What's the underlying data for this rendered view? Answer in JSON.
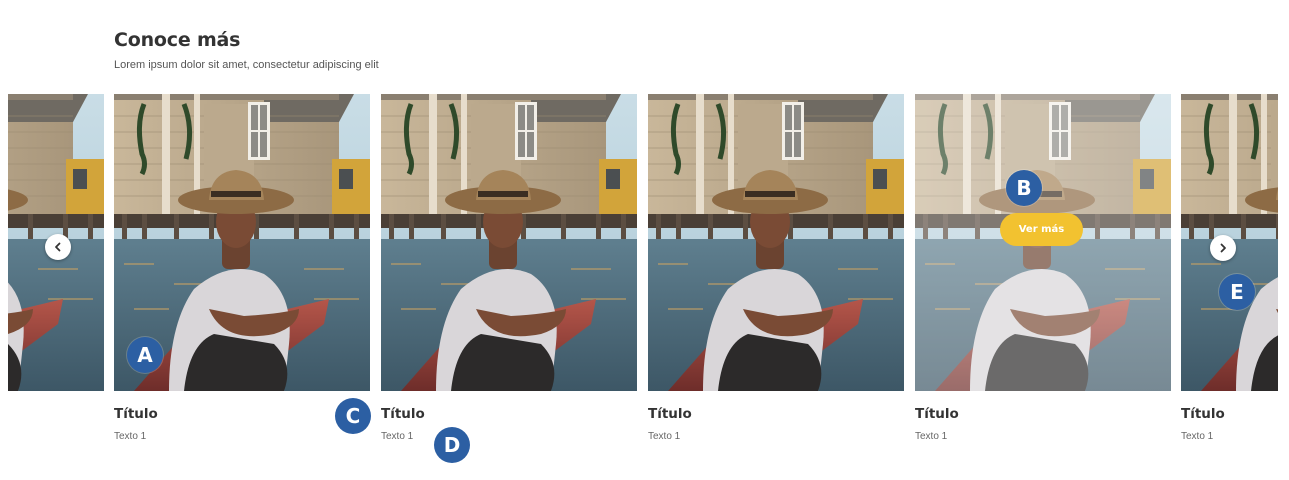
{
  "header": {
    "title": "Conoce más",
    "subtitle": "Lorem ipsum dolor sit amet, consectetur adipiscing elit"
  },
  "cards": [
    {
      "title": "",
      "text": ""
    },
    {
      "title": "Título",
      "text": "Texto 1"
    },
    {
      "title": "Título",
      "text": "Texto 1"
    },
    {
      "title": "Título",
      "text": "Texto 1"
    },
    {
      "title": "Título",
      "text": "Texto 1",
      "button_label": "Ver más"
    },
    {
      "title": "Título",
      "text": "Texto 1"
    }
  ],
  "navigation": {
    "prev_icon": "chevron-left-icon",
    "next_icon": "chevron-right-icon"
  },
  "markers": {
    "a": "A",
    "b": "B",
    "c": "C",
    "d": "D",
    "e": "E"
  },
  "colors": {
    "accent_button": "#f2c230",
    "marker": "#2c5fa3",
    "title": "#333333"
  }
}
